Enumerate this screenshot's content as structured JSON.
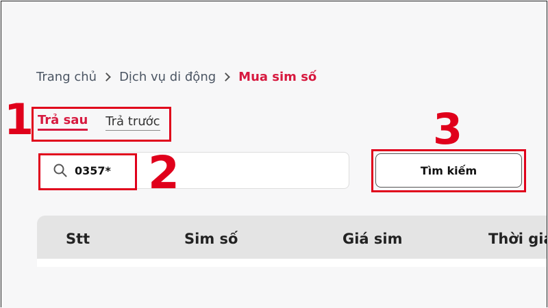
{
  "breadcrumb": {
    "home": "Trang chủ",
    "mobile_services": "Dịch vụ di động",
    "current": "Mua sim số"
  },
  "tabs": {
    "postpaid": "Trả sau",
    "prepaid": "Trả trước",
    "active": "postpaid"
  },
  "search": {
    "value": "0357*",
    "button_label": "Tìm kiếm"
  },
  "table": {
    "columns": [
      "Stt",
      "Sim số",
      "Giá sim",
      "Thời gia"
    ]
  },
  "annotations": {
    "step1": "1",
    "step2": "2",
    "step3": "3",
    "color": "#e0001b"
  },
  "colors": {
    "accent": "#d7193f",
    "table_header_bg": "#e4e4e4"
  }
}
